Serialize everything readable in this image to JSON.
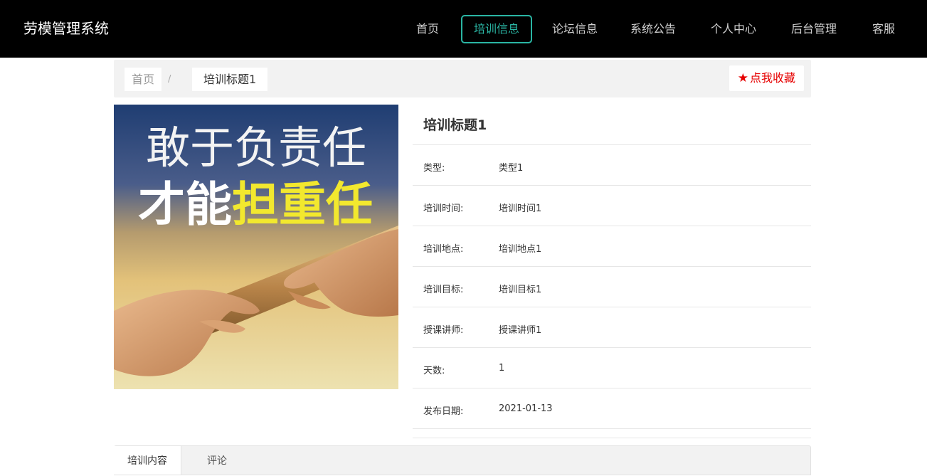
{
  "header": {
    "brand": "劳模管理系统",
    "nav": [
      {
        "label": "首页"
      },
      {
        "label": "培训信息",
        "active": true
      },
      {
        "label": "论坛信息"
      },
      {
        "label": "系统公告"
      },
      {
        "label": "个人中心"
      },
      {
        "label": "后台管理"
      },
      {
        "label": "客服"
      }
    ]
  },
  "breadcrumb": {
    "home": "首页",
    "separator": "/",
    "current": "培训标题1"
  },
  "favorite": {
    "icon": "star-icon",
    "label": "点我收藏"
  },
  "cover": {
    "line1": "敢于负责任",
    "line2_white": "才能",
    "line2_yellow": "担重任"
  },
  "detail": {
    "title": "培训标题1",
    "fields": [
      {
        "label": "类型:",
        "value": "类型1"
      },
      {
        "label": "培训时间:",
        "value": "培训时间1"
      },
      {
        "label": "培训地点:",
        "value": "培训地点1"
      },
      {
        "label": "培训目标:",
        "value": "培训目标1"
      },
      {
        "label": "授课讲师:",
        "value": "授课讲师1"
      },
      {
        "label": "天数:",
        "value": "1"
      },
      {
        "label": "发布日期:",
        "value": "2021-01-13"
      }
    ]
  },
  "tabs": [
    {
      "label": "培训内容",
      "active": true
    },
    {
      "label": "评论"
    }
  ],
  "colors": {
    "navbar_bg": "#000000",
    "accent": "#2ab5a3",
    "favorite": "#e60000",
    "cover_yellow": "#f2e82e"
  }
}
